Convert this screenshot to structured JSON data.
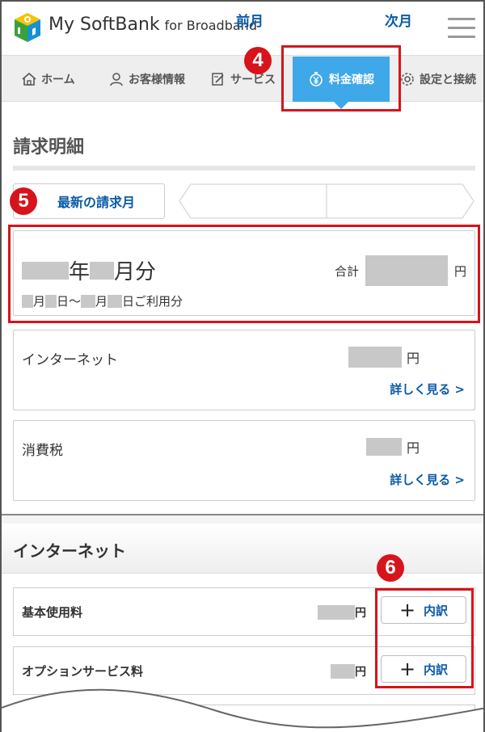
{
  "header": {
    "brand": "My SoftBank",
    "brand_sub": "for Broadband",
    "logo_icon": "softbank-logo-icon",
    "menu_icon": "hamburger-menu-icon"
  },
  "nav": {
    "items": [
      {
        "label": "ホーム",
        "icon": "home-icon"
      },
      {
        "label": "お客様情報",
        "icon": "user-icon"
      },
      {
        "label": "サービス",
        "icon": "edit-icon"
      },
      {
        "label": "料金確認",
        "icon": "yen-icon",
        "active": true
      },
      {
        "label": "設定と接続",
        "icon": "gear-icon"
      }
    ]
  },
  "badges": {
    "b4": "4",
    "b5": "5",
    "b6": "6"
  },
  "page_title": "請求明細",
  "tabs": {
    "latest": "最新の請求月",
    "prev": "前月",
    "next": "次月"
  },
  "bill": {
    "year_suffix": "年",
    "month_suffix": "月分",
    "total_label": "合計",
    "yen": "円",
    "period_m1": "月",
    "period_d1": "日〜",
    "period_m2": "月",
    "period_d2": "日ご利用分"
  },
  "items": [
    {
      "name": "インターネット",
      "yen": "円",
      "link": "詳しく見る >"
    },
    {
      "name": "消費税",
      "yen": "円",
      "link": "詳しく見る >"
    }
  ],
  "section": {
    "title": "インターネット"
  },
  "rows": [
    {
      "label": "基本使用料",
      "yen": "円",
      "button": "内訳"
    },
    {
      "label": "オプションサービス料",
      "yen": "円",
      "button": "内訳"
    }
  ],
  "colors": {
    "accent": "#3ea8e8",
    "highlight": "#d7131b",
    "link": "#0a5ba8"
  }
}
